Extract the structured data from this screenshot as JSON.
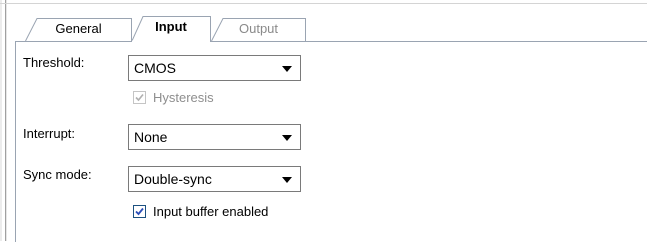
{
  "tabs": [
    {
      "label": "General",
      "state": "normal"
    },
    {
      "label": "Input",
      "state": "selected"
    },
    {
      "label": "Output",
      "state": "disabled"
    }
  ],
  "fields": {
    "threshold": {
      "label": "Threshold:",
      "value": "CMOS"
    },
    "hysteresis": {
      "label": "Hysteresis",
      "checked": true,
      "enabled": false
    },
    "interrupt": {
      "label": "Interrupt:",
      "value": "None"
    },
    "sync_mode": {
      "label": "Sync mode:",
      "value": "Double-sync"
    },
    "input_buffer": {
      "label": "Input buffer enabled",
      "checked": true,
      "enabled": true
    }
  },
  "colors": {
    "tab_border": "#9aa4b2",
    "checkbox_border": "#1c5180",
    "disabled_text": "#8e8e8e",
    "check_mark": "#2a4db8"
  },
  "icons": [
    "dropdown-arrow-icon",
    "checkmark-icon"
  ]
}
